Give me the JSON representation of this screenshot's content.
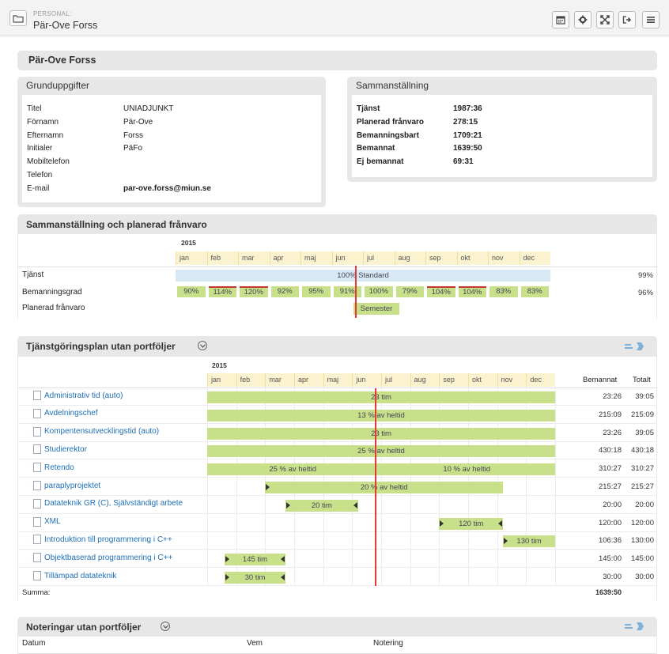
{
  "header": {
    "section_label": "PERSONAL:",
    "person_name": "Pär-Ove Forss"
  },
  "toolbar": {
    "icons": [
      "calendar-icon",
      "gear-icon",
      "expand-icon",
      "exit-icon",
      "menu-icon"
    ]
  },
  "profile": {
    "title": "Pär-Ove Forss"
  },
  "grund": {
    "title": "Grunduppgifter",
    "rows": [
      {
        "label": "Titel",
        "value": "UNIADJUNKT"
      },
      {
        "label": "Förnamn",
        "value": "Pär-Ove"
      },
      {
        "label": "Efternamn",
        "value": "Forss"
      },
      {
        "label": "Initialer",
        "value": "PäFo"
      },
      {
        "label": "Mobiltelefon",
        "value": ""
      },
      {
        "label": "Telefon",
        "value": ""
      },
      {
        "label": "E-mail",
        "value": "par-ove.forss@miun.se"
      }
    ]
  },
  "samman": {
    "title": "Sammanställning",
    "rows": [
      {
        "label": "Tjänst",
        "value": "1987:36"
      },
      {
        "label": "Planerad frånvaro",
        "value": "278:15"
      },
      {
        "label": "Bemanningsbart",
        "value": "1709:21"
      },
      {
        "label": "Bemannat",
        "value": "1639:50"
      },
      {
        "label": "Ej bemannat",
        "value": "69:31"
      }
    ]
  },
  "planfr": {
    "title": "Sammanställning och planerad frånvaro",
    "year": "2015",
    "months": [
      "jan",
      "feb",
      "mar",
      "apr",
      "maj",
      "jun",
      "jul",
      "aug",
      "sep",
      "okt",
      "nov",
      "dec"
    ],
    "tjanst_label": "Tjänst",
    "tjanst_bar": "100% Standard",
    "tjanst_total": "99%",
    "bem_label": "Bemanningsgrad",
    "bem_values": [
      "90%",
      "114%",
      "120%",
      "92%",
      "95%",
      "91%",
      "100%",
      "79%",
      "104%",
      "104%",
      "83%",
      "83%"
    ],
    "bem_total": "96%",
    "franvaro_label": "Planerad frånvaro",
    "franvaro_bar": "Semester"
  },
  "tjplan": {
    "title": "Tjänstgöringsplan utan portföljer",
    "year": "2015",
    "months": [
      "jan",
      "feb",
      "mar",
      "apr",
      "maj",
      "jun",
      "jul",
      "aug",
      "sep",
      "okt",
      "nov",
      "dec"
    ],
    "col_bemannat": "Bemannat",
    "col_totalt": "Totalt",
    "rows": [
      {
        "name": "Administrativ tid (auto)",
        "bar": "23 tim",
        "bemannat": "23:26",
        "totalt": "39:05"
      },
      {
        "name": "Avdelningschef",
        "bar": "13 % av heltid",
        "bemannat": "215:09",
        "totalt": "215:09"
      },
      {
        "name": "Kompentensutvecklingstid (auto)",
        "bar": "23 tim",
        "bemannat": "23:26",
        "totalt": "39:05"
      },
      {
        "name": "Studierektor",
        "bar": "25 % av heltid",
        "bemannat": "430:18",
        "totalt": "430:18"
      },
      {
        "name": "Retendo",
        "bar": "25 % av heltid",
        "bar2": "10 % av heltid",
        "bemannat": "310:27",
        "totalt": "310:27"
      },
      {
        "name": "paraplyprojektet",
        "bar": "20 % av heltid",
        "bemannat": "215:27",
        "totalt": "215:27"
      },
      {
        "name": "Datateknik GR (C), Självständigt arbete",
        "bar": "20 tim",
        "bemannat": "20:00",
        "totalt": "20:00"
      },
      {
        "name": "XML",
        "bar": "120 tim",
        "bemannat": "120:00",
        "totalt": "120:00"
      },
      {
        "name": "Introduktion till programmering i C++",
        "bar": "130 tim",
        "bemannat": "106:36",
        "totalt": "130:00"
      },
      {
        "name": "Objektbaserad programmering i C++",
        "bar": "145 tim",
        "bemannat": "145:00",
        "totalt": "145:00"
      },
      {
        "name": "Tillämpad datateknik",
        "bar": "30 tim",
        "bemannat": "30:00",
        "totalt": "30:00"
      }
    ],
    "summa_label": "Summa:",
    "summa_value": "1639:50"
  },
  "notes": {
    "title": "Noteringar utan portföljer",
    "col_datum": "Datum",
    "col_vem": "Vem",
    "col_notering": "Notering"
  }
}
